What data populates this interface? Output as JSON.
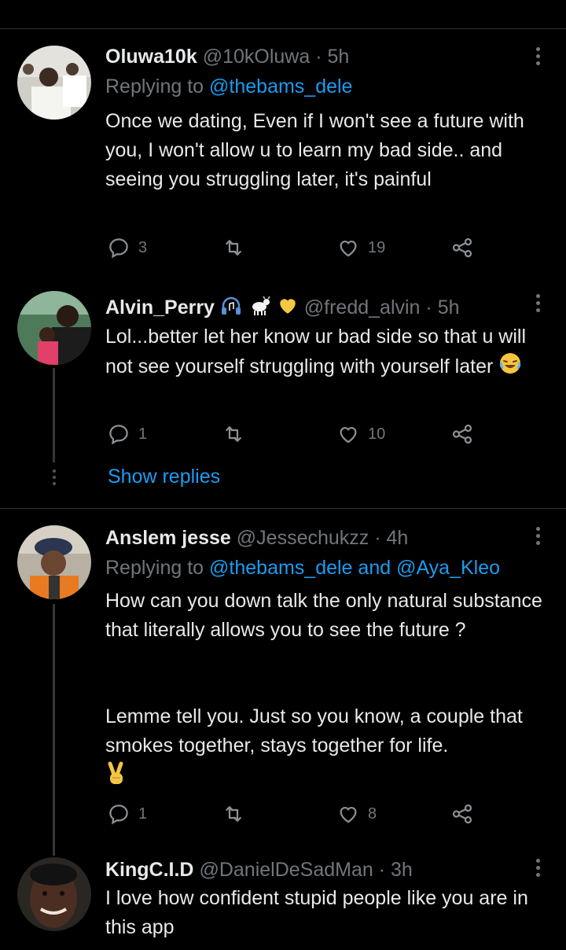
{
  "tweets": [
    {
      "name": "Oluwa10k",
      "handle": "@10kOluwa",
      "time": "5h",
      "replying_prefix": "Replying to ",
      "replying_to": "@thebams_dele",
      "text": "Once we dating, Even if I won't see a future with you, I won't allow u to learn my bad side.. and seeing you struggling later, it's painful",
      "replies": "3",
      "retweets": "",
      "likes": "19"
    },
    {
      "name": "Alvin_Perry",
      "handle": "@fredd_alvin",
      "time": "5h",
      "text": "Lol...better let her know ur bad side so that u will not see yourself struggling with yourself later",
      "replies": "1",
      "retweets": "",
      "likes": "10",
      "show_replies": "Show replies"
    },
    {
      "name": "Anslem jesse",
      "handle": "@Jessechukzz",
      "time": "4h",
      "replying_prefix": "Replying to ",
      "replying_to": "@thebams_dele and @Aya_Kleo",
      "text_p1": "How can you down talk the only natural substance that literally allows you to see the future ?",
      "text_p2": "Lemme tell you. Just so you know, a couple that smokes together, stays together for life.",
      "replies": "1",
      "retweets": "",
      "likes": "8"
    },
    {
      "name": "KingC.I.D",
      "handle": "@DanielDeSadMan",
      "time": "3h",
      "text": "I love how confident stupid people like you are in this app"
    }
  ],
  "separator": "·",
  "colors": {
    "background": "#000000",
    "text": "#e7e9ea",
    "muted": "#71767b",
    "link": "#1d9bf0",
    "divider": "#2f3336"
  },
  "icons": [
    "reply-icon",
    "retweet-icon",
    "like-icon",
    "share-icon",
    "more-icon",
    "headphones-icon",
    "goat-icon",
    "yellow-heart-icon",
    "laughing-emoji",
    "victory-hand-emoji"
  ]
}
